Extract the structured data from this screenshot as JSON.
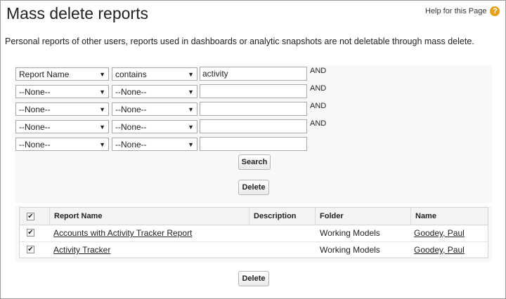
{
  "header": {
    "title": "Mass delete reports",
    "help_label": "Help for this Page",
    "help_icon": "?"
  },
  "description": "Personal reports of other users, reports used in dashboards or analytic snapshots are not deletable through mass delete.",
  "criteria": [
    {
      "field": "Report Name",
      "operator": "contains",
      "value": "activity",
      "connector": "AND"
    },
    {
      "field": "--None--",
      "operator": "--None--",
      "value": "",
      "connector": "AND"
    },
    {
      "field": "--None--",
      "operator": "--None--",
      "value": "",
      "connector": "AND"
    },
    {
      "field": "--None--",
      "operator": "--None--",
      "value": "",
      "connector": "AND"
    },
    {
      "field": "--None--",
      "operator": "--None--",
      "value": "",
      "connector": ""
    }
  ],
  "buttons": {
    "search": "Search",
    "delete_top": "Delete",
    "delete_bottom": "Delete"
  },
  "table": {
    "select_all_checked": true,
    "columns": [
      "Report Name",
      "Description",
      "Folder",
      "Name"
    ],
    "rows": [
      {
        "checked": true,
        "report_name": "Accounts with Activity Tracker Report",
        "description": "",
        "folder": "Working Models",
        "name": "Goodey, Paul"
      },
      {
        "checked": true,
        "report_name": "Activity Tracker",
        "description": "",
        "folder": "Working Models",
        "name": "Goodey, Paul"
      }
    ]
  },
  "glyphs": {
    "check": "✔",
    "dropdown": "▼"
  }
}
